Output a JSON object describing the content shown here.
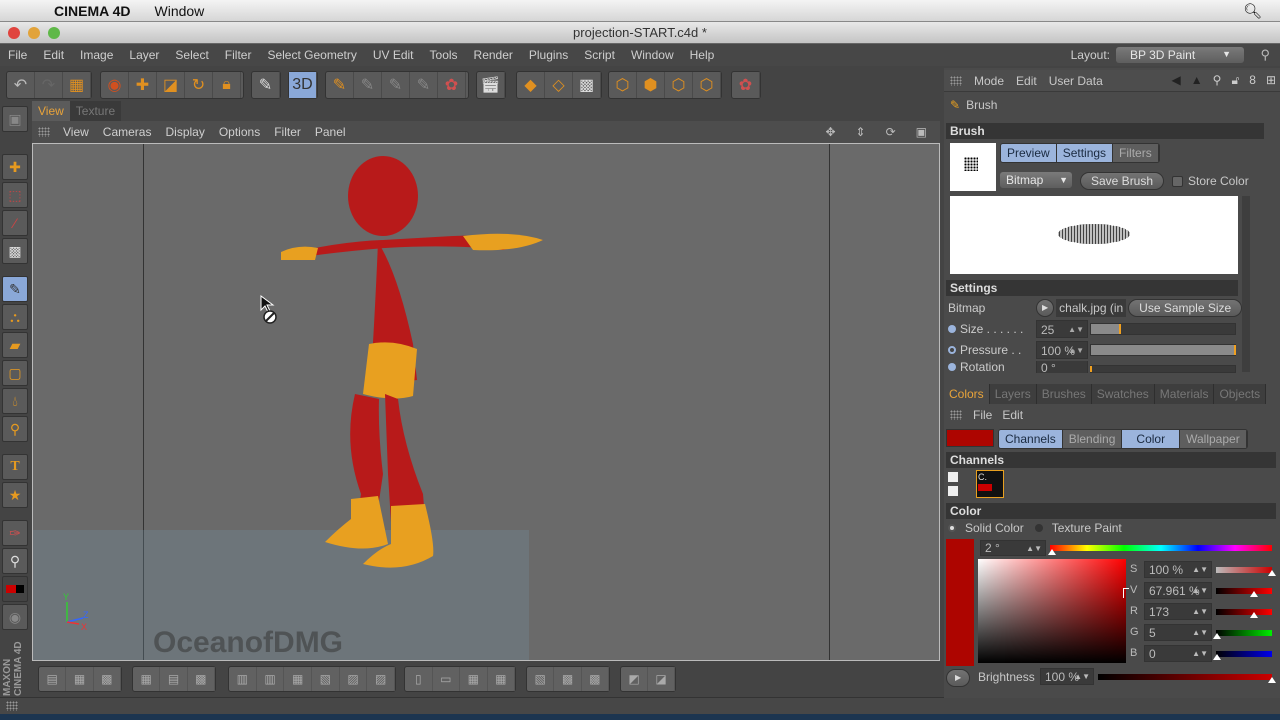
{
  "mac_menubar": {
    "app_name": "CINEMA 4D",
    "menu": "Window"
  },
  "window": {
    "title": "projection-START.c4d *"
  },
  "menubar": {
    "items": [
      "File",
      "Edit",
      "Image",
      "Layer",
      "Select",
      "Filter",
      "Select Geometry",
      "UV Edit",
      "Tools",
      "Render",
      "Plugins",
      "Script",
      "Window",
      "Help"
    ],
    "layout_label": "Layout:",
    "layout_value": "BP 3D Paint"
  },
  "viewport": {
    "tabs": [
      "View",
      "Texture"
    ],
    "active_tab": "View",
    "menu": [
      "View",
      "Cameras",
      "Display",
      "Options",
      "Filter",
      "Panel"
    ],
    "axis_labels": {
      "y": "Y",
      "z": "Z",
      "x": "X"
    },
    "watermark": "OceanofDMG"
  },
  "attributes": {
    "menu": [
      "Mode",
      "Edit",
      "User Data"
    ],
    "object_name": "Brush",
    "brush_section": "Brush",
    "brush_tabs": [
      "Preview",
      "Settings",
      "Filters"
    ],
    "brush_type": "Bitmap",
    "save_brush": "Save Brush",
    "store_color": "Store Color",
    "settings_section": "Settings",
    "bitmap_label": "Bitmap",
    "bitmap_file": "chalk.jpg (in",
    "use_sample_size": "Use Sample Size",
    "params": [
      {
        "label": "Size . . . . . .",
        "value": "25",
        "fraction": 0.2
      },
      {
        "label": "Pressure . .",
        "value": "100 %",
        "fraction": 1.0
      },
      {
        "label": "Rotation",
        "value": "0 °",
        "fraction": 0.0
      }
    ]
  },
  "bottom_panel": {
    "tabs": [
      "Colors",
      "Layers",
      "Brushes",
      "Swatches",
      "Materials",
      "Objects"
    ],
    "active_tab": "Colors",
    "menu": [
      "File",
      "Edit"
    ],
    "color_tabs": [
      "Channels",
      "Blending",
      "Color",
      "Wallpaper"
    ],
    "channels_section": "Channels",
    "channel_thumb_label": "C.",
    "color_section": "Color",
    "mode_options": [
      "Solid Color",
      "Texture Paint"
    ],
    "current_color": "#ad0500",
    "hue": "2 °",
    "S": {
      "label": "S",
      "value": "100 %"
    },
    "V": {
      "label": "V",
      "value": "67.961 %"
    },
    "R": {
      "label": "R",
      "value": "173"
    },
    "G": {
      "label": "G",
      "value": "5"
    },
    "B": {
      "label": "B",
      "value": "0"
    },
    "brightness_label": "Brightness",
    "brightness_value": "100 %"
  },
  "brand": {
    "logo": "MAXON CINEMA 4D"
  }
}
